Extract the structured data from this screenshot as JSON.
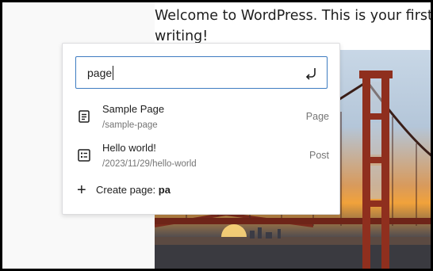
{
  "post": {
    "paragraph_line1": "Welcome to WordPress. This is your first post.",
    "paragraph_line2": "writing!"
  },
  "link_popover": {
    "search": {
      "value": "page",
      "submit_icon": "enter-icon"
    },
    "results": [
      {
        "title": "Sample Page",
        "url": "/sample-page",
        "type": "Page",
        "icon": "page-icon"
      },
      {
        "title": "Hello world!",
        "url": "/2023/11/29/hello-world",
        "type": "Post",
        "icon": "post-icon"
      }
    ],
    "create": {
      "prefix": "Create page: ",
      "term": "pa",
      "icon": "plus-icon"
    }
  },
  "colors": {
    "focus": "#3e7cc1",
    "muted": "#757575",
    "text": "#1e1e1e"
  }
}
